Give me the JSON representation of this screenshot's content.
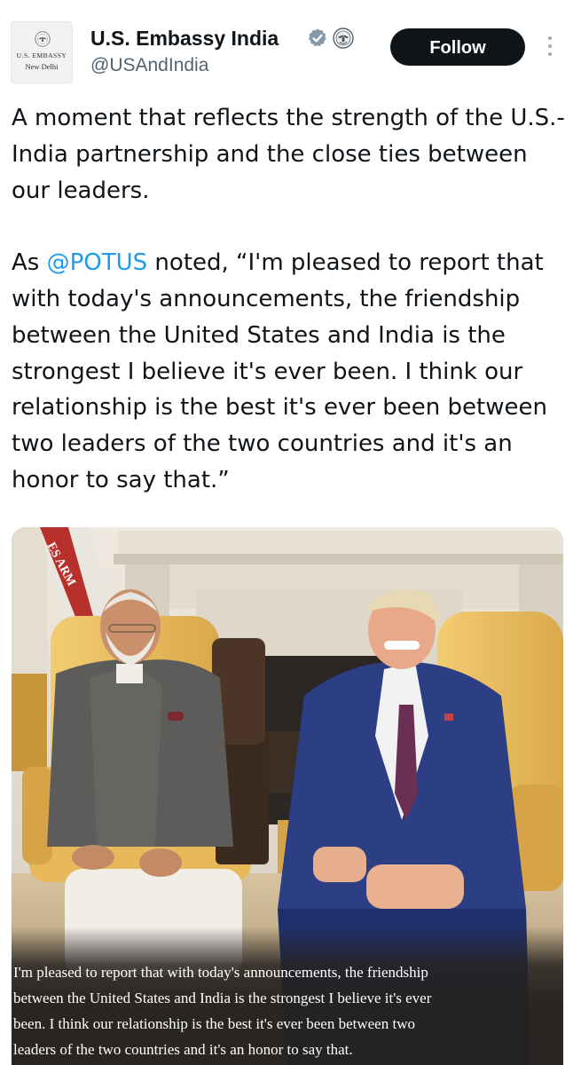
{
  "account": {
    "display_name": "U.S. Embassy India",
    "handle": "@USAndIndia",
    "avatar_line1": "U.S. EMBASSY",
    "avatar_line2": "New Delhi",
    "verified_icon": "verified-badge-icon",
    "affiliation_icon": "government-seal-icon"
  },
  "actions": {
    "follow_label": "Follow",
    "more_icon": "more-vertical-icon"
  },
  "tweet": {
    "para1": "A moment that reflects the strength of the U.S.-India partnership and the close ties between our leaders.",
    "para2_before": "As ",
    "mention": "@POTUS",
    "para2_after": " noted, “I'm pleased to report that with today's announcements, the friendship between the United States and India is the strongest I believe it's ever been. I think our relationship is the best it's ever been between two leaders of the two countries and it's an honor to say that.”"
  },
  "media": {
    "quote_lines": [
      "I'm pleased to report that with today's announcements, the friendship",
      "between the United States and India is the strongest I believe it's ever",
      "been. I think our relationship is the best it's ever been between two",
      "leaders of the two countries and it's an honor to say that."
    ],
    "flag_text": "ES ARM",
    "colors": {
      "chair": "#ecc266",
      "suit_blue": "#2c3f85",
      "vest_grey": "#5d5c5a",
      "overlay": "#26221f"
    }
  },
  "colors": {
    "text": "#0f1419",
    "secondary": "#536471",
    "link": "#1d9bf0",
    "follow_bg": "#0f1419"
  }
}
